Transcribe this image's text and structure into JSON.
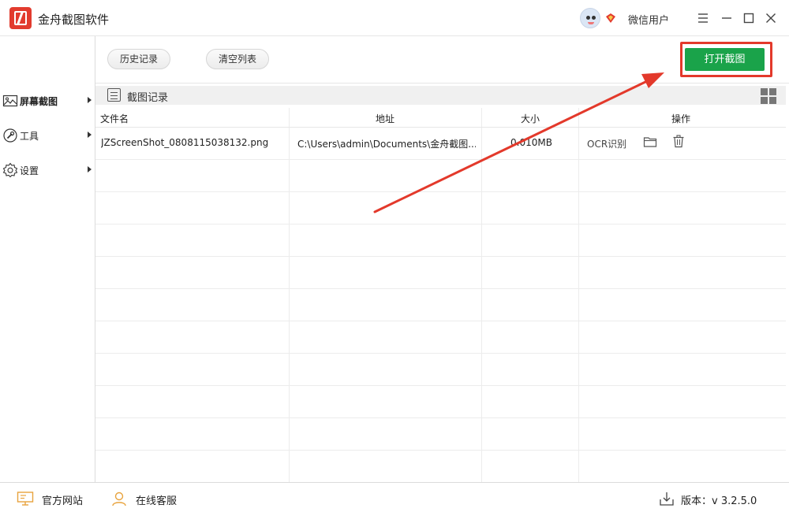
{
  "app": {
    "title": "金舟截图软件",
    "username": "微信用户"
  },
  "sidebar": {
    "items": [
      {
        "label": "屏幕截图",
        "icon": "image-icon"
      },
      {
        "label": "工具",
        "icon": "wrench-icon"
      },
      {
        "label": "设置",
        "icon": "gear-icon"
      }
    ]
  },
  "toolbar": {
    "history_label": "历史记录",
    "clear_label": "清空列表",
    "open_label": "打开截图"
  },
  "section": {
    "title": "截图记录"
  },
  "table": {
    "headers": [
      "文件名",
      "地址",
      "大小",
      "操作"
    ],
    "rows": [
      {
        "name": "JZScreenShot_0808115038132.png",
        "path": "C:\\Users\\admin\\Documents\\金舟截图...",
        "size": "0.010MB",
        "ocr_label": "OCR识别"
      }
    ]
  },
  "statusbar": {
    "site_label": "官方网站",
    "service_label": "在线客服",
    "version_label": "版本：v 3.2.5.0"
  },
  "colors": {
    "accent_green": "#1aa34a",
    "annotation_red": "#e3392b",
    "logo_red": "#e23b2e"
  }
}
